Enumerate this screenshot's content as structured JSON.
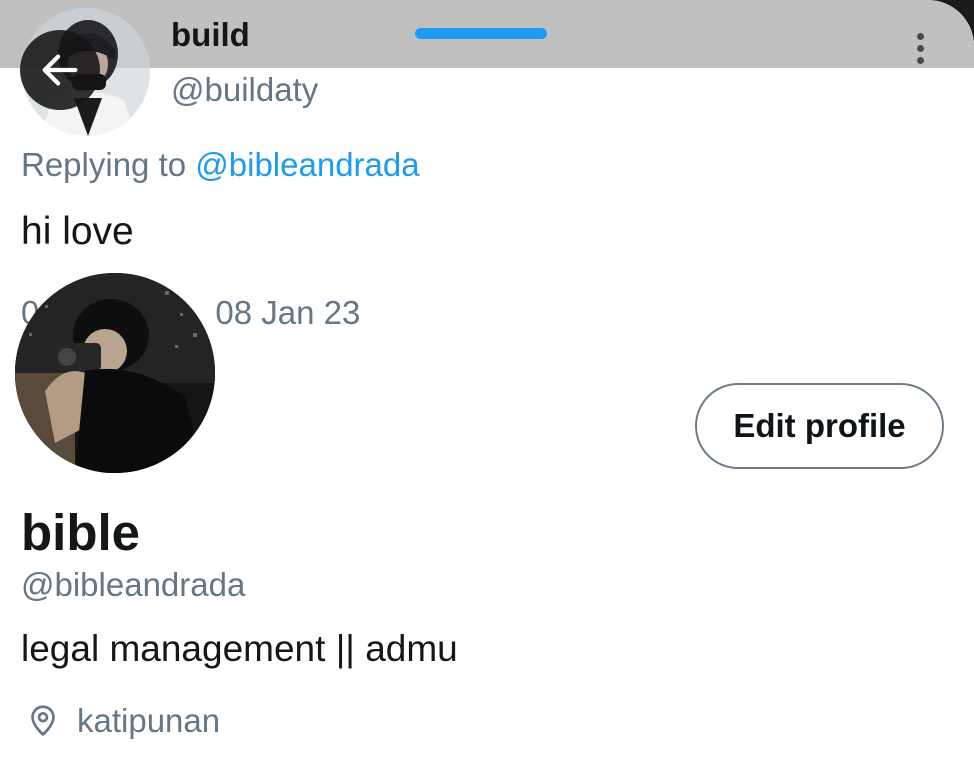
{
  "header": {
    "scroll_indicator_color": "#1d9bf0",
    "back_icon": "arrow-left-icon",
    "more_icon": "more-vertical-icon"
  },
  "tweet": {
    "author_name": "build",
    "author_handle": "@buildaty",
    "replying_to_label": "Replying to ",
    "replying_to_handle": "@bibleandrada",
    "text": "hi love",
    "timestamp_visible": "08 Jan 23",
    "timestamp_prefix_partial": "0"
  },
  "profile": {
    "edit_button_label": "Edit profile",
    "name": "bible",
    "handle": "@bibleandrada",
    "bio": "legal management || admu",
    "location_icon": "location-pin-icon",
    "location": "katipunan"
  },
  "colors": {
    "primary_text": "#14171a",
    "secondary_text": "#657786",
    "link": "#1d9bf0",
    "topbar": "#c0c0c0"
  }
}
